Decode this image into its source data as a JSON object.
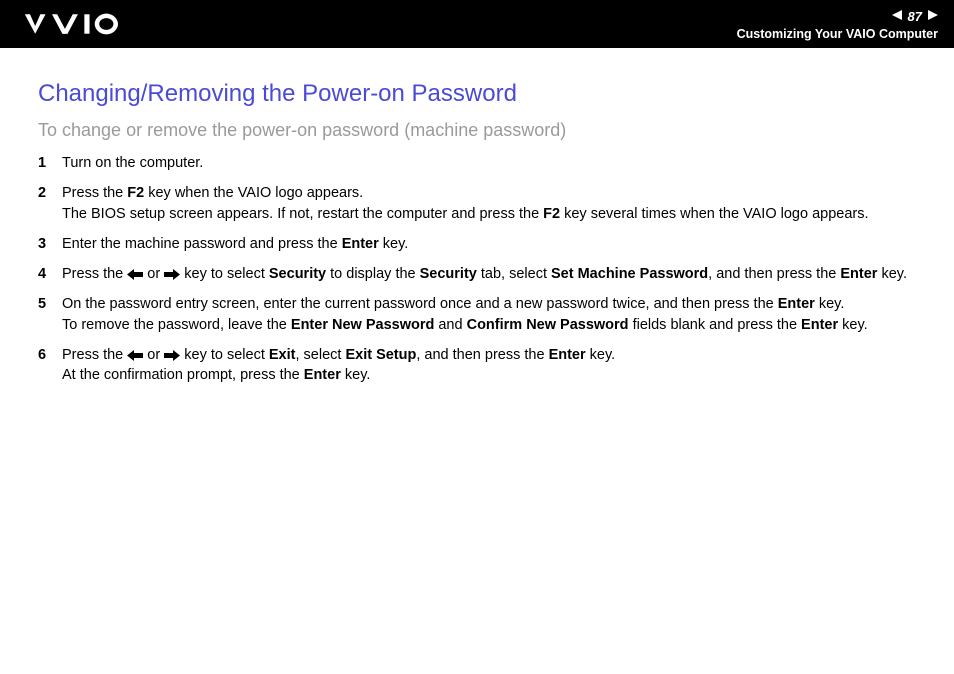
{
  "header": {
    "page_number": "87",
    "section": "Customizing Your VAIO Computer"
  },
  "title": "Changing/Removing the Power-on Password",
  "subtitle": "To change or remove the power-on password (machine password)",
  "steps": [
    {
      "num": "1",
      "segments": [
        {
          "t": "Turn on the computer."
        }
      ]
    },
    {
      "num": "2",
      "segments": [
        {
          "t": "Press the "
        },
        {
          "t": "F2",
          "b": true
        },
        {
          "t": " key when the VAIO logo appears."
        },
        {
          "br": true
        },
        {
          "t": "The BIOS setup screen appears. If not, restart the computer and press the "
        },
        {
          "t": "F2",
          "b": true
        },
        {
          "t": " key several times when the VAIO logo appears."
        }
      ]
    },
    {
      "num": "3",
      "segments": [
        {
          "t": "Enter the machine password and press the "
        },
        {
          "t": "Enter",
          "b": true
        },
        {
          "t": " key."
        }
      ]
    },
    {
      "num": "4",
      "segments": [
        {
          "t": "Press the "
        },
        {
          "arrow": "left"
        },
        {
          "t": " or "
        },
        {
          "arrow": "right"
        },
        {
          "t": " key to select "
        },
        {
          "t": "Security",
          "b": true
        },
        {
          "t": " to display the "
        },
        {
          "t": "Security",
          "b": true
        },
        {
          "t": " tab, select "
        },
        {
          "t": "Set Machine Password",
          "b": true
        },
        {
          "t": ", and then press the "
        },
        {
          "t": "Enter",
          "b": true
        },
        {
          "t": " key."
        }
      ]
    },
    {
      "num": "5",
      "segments": [
        {
          "t": "On the password entry screen, enter the current password once and a new password twice, and then press the "
        },
        {
          "t": "Enter",
          "b": true
        },
        {
          "t": " key."
        },
        {
          "br": true
        },
        {
          "t": "To remove the password, leave the "
        },
        {
          "t": "Enter New Password",
          "b": true
        },
        {
          "t": " and "
        },
        {
          "t": "Confirm New Password",
          "b": true
        },
        {
          "t": " fields blank and press the "
        },
        {
          "t": "Enter",
          "b": true
        },
        {
          "t": " key."
        }
      ]
    },
    {
      "num": "6",
      "segments": [
        {
          "t": "Press the "
        },
        {
          "arrow": "left"
        },
        {
          "t": " or "
        },
        {
          "arrow": "right"
        },
        {
          "t": " key to select "
        },
        {
          "t": "Exit",
          "b": true
        },
        {
          "t": ", select "
        },
        {
          "t": "Exit Setup",
          "b": true
        },
        {
          "t": ", and then press the "
        },
        {
          "t": "Enter",
          "b": true
        },
        {
          "t": " key."
        },
        {
          "br": true
        },
        {
          "t": "At the confirmation prompt, press the "
        },
        {
          "t": "Enter",
          "b": true
        },
        {
          "t": " key."
        }
      ]
    }
  ]
}
